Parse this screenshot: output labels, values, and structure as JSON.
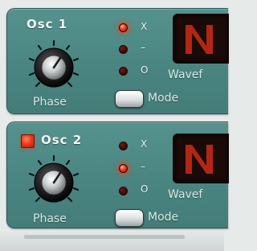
{
  "osc1": {
    "title": "Osc 1",
    "knob_label": "Phase",
    "phase_modes": [
      {
        "symbol": "X",
        "active": true
      },
      {
        "symbol": "–",
        "active": false
      },
      {
        "symbol": "O",
        "active": false
      }
    ],
    "mode_label": "Mode",
    "wave_label": "Wavef",
    "enabled": true
  },
  "osc2": {
    "title": "Osc 2",
    "knob_label": "Phase",
    "phase_modes": [
      {
        "symbol": "X",
        "active": false
      },
      {
        "symbol": "–",
        "active": true
      },
      {
        "symbol": "O",
        "active": false
      }
    ],
    "mode_label": "Mode",
    "wave_label": "Wavef",
    "enabled": true
  },
  "colors": {
    "panel": "#4a8581",
    "led_on": "#ff3b18",
    "display_glyph": "#c22a16"
  }
}
